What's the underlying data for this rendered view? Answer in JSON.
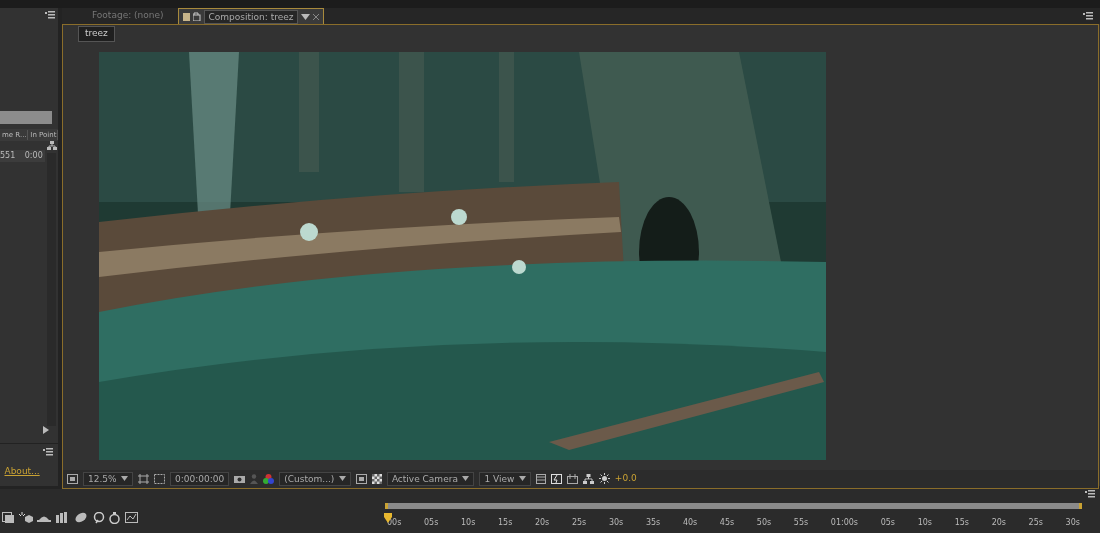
{
  "project_panel": {
    "column_headers": [
      "me R...",
      "In Point"
    ],
    "row": [
      "551",
      "0:00"
    ],
    "link": "About..."
  },
  "tabs": [
    {
      "label": "Footage: (none)",
      "selected": false
    },
    {
      "label": "Composition: treez",
      "selected": true
    }
  ],
  "breadcrumb": "treez",
  "viewer_toolbar": {
    "zoom": "12.5%",
    "timecode": "0:00:00:00",
    "resolution": "(Custom...)",
    "camera": "Active Camera",
    "views": "1 View",
    "exposure": "+0.0"
  },
  "timeline": {
    "ruler_labels": [
      "00s",
      "05s",
      "10s",
      "15s",
      "20s",
      "25s",
      "30s",
      "35s",
      "40s",
      "45s",
      "50s",
      "55s",
      "01:00s",
      "05s",
      "10s",
      "15s",
      "20s",
      "25s",
      "30s"
    ]
  }
}
